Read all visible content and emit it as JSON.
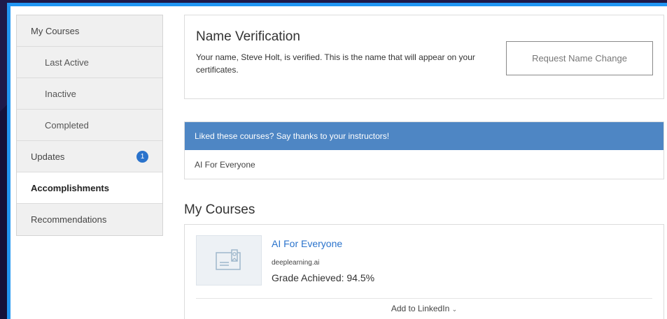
{
  "sidebar": {
    "items": [
      {
        "label": "My Courses"
      },
      {
        "label": "Last Active"
      },
      {
        "label": "Inactive"
      },
      {
        "label": "Completed"
      },
      {
        "label": "Updates",
        "badge": "1"
      },
      {
        "label": "Accomplishments"
      },
      {
        "label": "Recommendations"
      }
    ]
  },
  "name_verification": {
    "title": "Name Verification",
    "description": "Your name, Steve Holt, is verified. This is the name that will appear on your certificates.",
    "button_label": "Request Name Change"
  },
  "thanks": {
    "header": "Liked these courses? Say thanks to your instructors!",
    "course": "AI For Everyone"
  },
  "my_courses": {
    "title": "My Courses",
    "course": {
      "name": "AI For Everyone",
      "partner": "deeplearning.ai",
      "grade": "Grade Achieved: 94.5%",
      "linkedin_label": "Add to LinkedIn",
      "thumbnail_icon": "certificate-icon"
    }
  },
  "colors": {
    "accent_blue": "#2a73cc",
    "thanks_header": "#4e86c4",
    "frame_border": "#2196f3",
    "backdrop": "#1e1a4a"
  }
}
